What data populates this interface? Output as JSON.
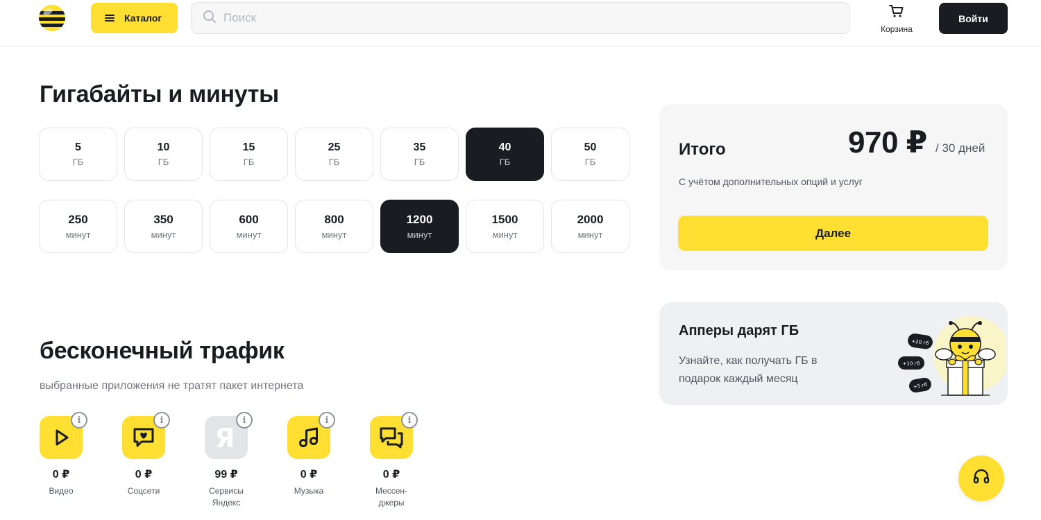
{
  "header": {
    "catalog_label": "Каталог",
    "search_placeholder": "Поиск",
    "search_value": "",
    "cart_label": "Корзина",
    "login_label": "Войти",
    "icons": {
      "logo": "beeline-logo-icon",
      "catalog": "menu-icon",
      "search": "search-icon",
      "cart": "cart-icon"
    }
  },
  "tariff": {
    "title": "Гигабайты и минуты",
    "gb_options": [
      {
        "value": "5",
        "unit": "ГБ",
        "selected": false
      },
      {
        "value": "10",
        "unit": "ГБ",
        "selected": false
      },
      {
        "value": "15",
        "unit": "ГБ",
        "selected": false
      },
      {
        "value": "25",
        "unit": "ГБ",
        "selected": false
      },
      {
        "value": "35",
        "unit": "ГБ",
        "selected": false
      },
      {
        "value": "40",
        "unit": "ГБ",
        "selected": true
      },
      {
        "value": "50",
        "unit": "ГБ",
        "selected": false
      }
    ],
    "minute_options": [
      {
        "value": "250",
        "unit": "минут",
        "selected": false
      },
      {
        "value": "350",
        "unit": "минут",
        "selected": false
      },
      {
        "value": "600",
        "unit": "минут",
        "selected": false
      },
      {
        "value": "800",
        "unit": "минут",
        "selected": false
      },
      {
        "value": "1200",
        "unit": "минут",
        "selected": true
      },
      {
        "value": "1500",
        "unit": "минут",
        "selected": false
      },
      {
        "value": "2000",
        "unit": "минут",
        "selected": false
      }
    ]
  },
  "unlimited": {
    "title": "бесконечный трафик",
    "subtitle": "выбранные приложения не тратят пакет интернета",
    "apps": [
      {
        "price": "0 ₽",
        "name": "Видео",
        "icon": "play-icon",
        "enabled": true
      },
      {
        "price": "0 ₽",
        "name": "Соцсети",
        "icon": "social-heart-icon",
        "enabled": true
      },
      {
        "price": "99 ₽",
        "name": "Сервисы Яндекс",
        "icon": "yandex-icon",
        "enabled": false
      },
      {
        "price": "0 ₽",
        "name": "Музыка",
        "icon": "music-note-icon",
        "enabled": true
      },
      {
        "price": "0 ₽",
        "name": "Мессен-джеры",
        "icon": "messenger-icon",
        "enabled": true
      }
    ],
    "info_icon": "info-icon"
  },
  "total": {
    "title": "Итого",
    "price": "970 ₽",
    "period": "/ 30 дней",
    "note": "С учётом дополнительных опций и услуг",
    "next_label": "Далее"
  },
  "promo": {
    "title": "Апперы дарят ГБ",
    "text": "Узнайте, как получать ГБ в подарок каждый месяц",
    "badges": [
      "+20 гб",
      "+10 гб",
      "+5 гб"
    ],
    "illustration": "bee-gift-illustration"
  },
  "support": {
    "icon": "headset-icon"
  },
  "colors": {
    "accent": "#ffe032",
    "dark": "#191c21",
    "muted": "#737780",
    "card": "#f6f6f7"
  }
}
